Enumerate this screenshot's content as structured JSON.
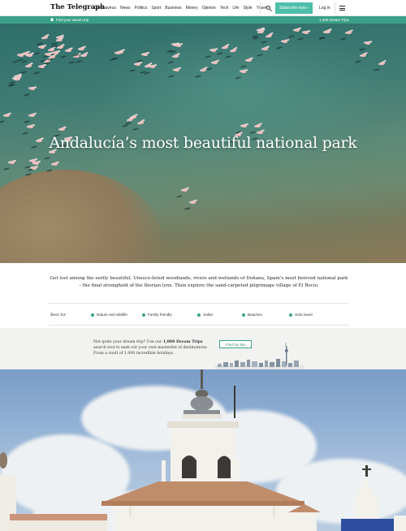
{
  "header": {
    "logo": "The Telegraph",
    "nav": [
      "Coronavirus",
      "News",
      "Politics",
      "Sport",
      "Business",
      "Money",
      "Opinion",
      "Tech",
      "Life",
      "Style",
      "Travel"
    ],
    "nav_more": "›",
    "subscribe": "Subscribe now ›",
    "login": "Log in",
    "search_icon": "search-icon",
    "menu_icon": "hamburger-menu-icon"
  },
  "subbar": {
    "find": "Find your dream trip",
    "dream": "1,000 Dream Trips",
    "color": "#3aa188"
  },
  "hero": {
    "title": "Andalucía’s most beautiful national park"
  },
  "intro": {
    "text": "Get lost among the eerily beautiful, Unesco-listed woodlands, rivers and wetlands of Doñana, Spain’s most beloved national park – the final stronghold of the Iberian lynx. Then explore the sand-carpeted pilgrimage village of El Rocío."
  },
  "best_for": {
    "label": "Best for",
    "items": [
      "Nature and wildlife",
      "Family friendly",
      "Safari",
      "Beaches",
      "Solo travel"
    ]
  },
  "promo": {
    "text_pre": "Not quite your dream trip? Use our ",
    "text_bold": "1,000 Dream Trips",
    "text_post": " search tool to seek out your own masterlist of destinations. From a vault of 1,000 incredible holidays.",
    "button": "Find my trip"
  }
}
